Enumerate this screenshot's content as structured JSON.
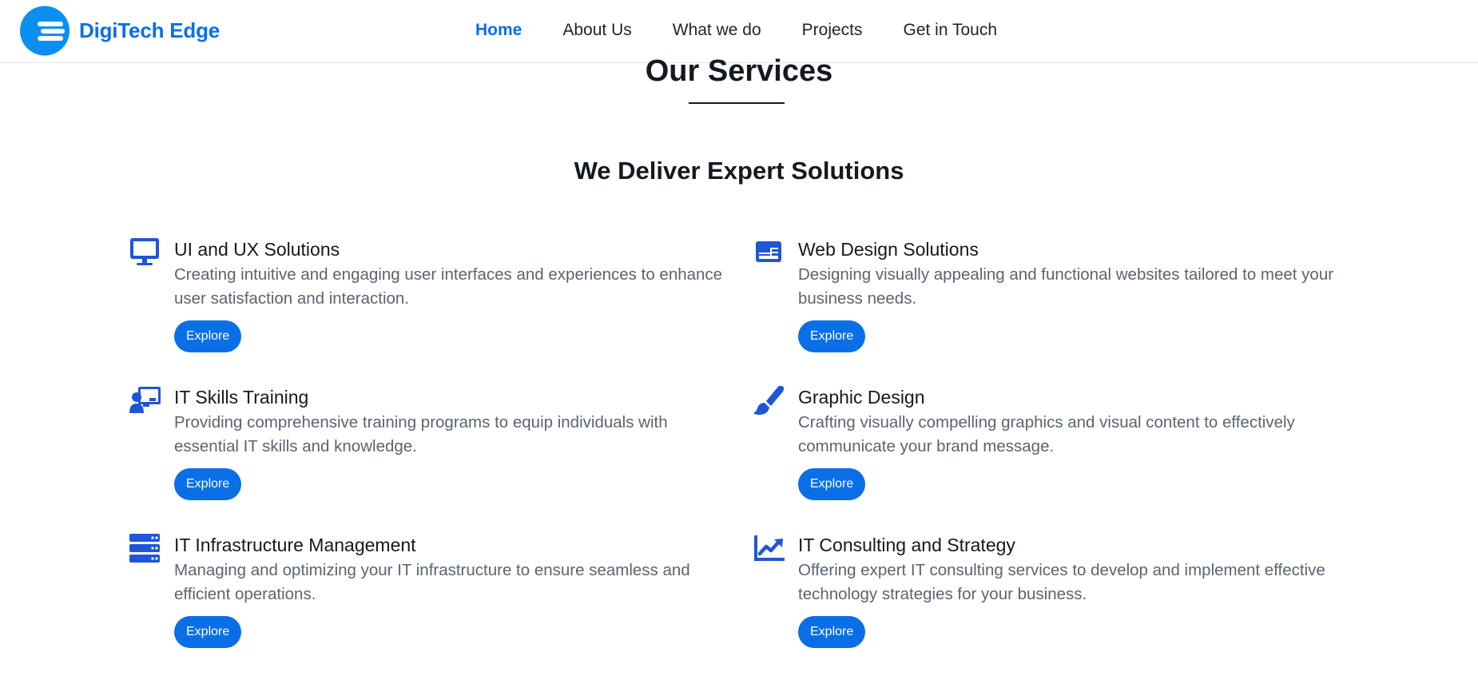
{
  "brand": {
    "name": "DigiTech Edge",
    "accent": "#0a6fe6"
  },
  "nav": {
    "items": [
      {
        "label": "Home",
        "active": true
      },
      {
        "label": "About Us",
        "active": false
      },
      {
        "label": "What we do",
        "active": false
      },
      {
        "label": "Projects",
        "active": false
      },
      {
        "label": "Get in Touch",
        "active": false
      }
    ]
  },
  "main": {
    "title": "Our Services",
    "subtitle": "We Deliver Expert Solutions",
    "services": [
      {
        "icon": "monitor-icon",
        "title": "UI and UX Solutions",
        "description": "Creating intuitive and engaging user interfaces and experiences to enhance user satisfaction and interaction.",
        "button": "Explore"
      },
      {
        "icon": "web-layout-icon",
        "title": "Web Design Solutions",
        "description": "Designing visually appealing and functional websites tailored to meet your business needs.",
        "button": "Explore"
      },
      {
        "icon": "teacher-board-icon",
        "title": "IT Skills Training",
        "description": "Providing comprehensive training programs to equip individuals with essential IT skills and knowledge.",
        "button": "Explore"
      },
      {
        "icon": "paint-brush-icon",
        "title": "Graphic Design",
        "description": "Crafting visually compelling graphics and visual content to effectively communicate your brand message.",
        "button": "Explore"
      },
      {
        "icon": "server-icon",
        "title": "IT Infrastructure Management",
        "description": "Managing and optimizing your IT infrastructure to ensure seamless and efficient operations.",
        "button": "Explore"
      },
      {
        "icon": "chart-line-icon",
        "title": "IT Consulting and Strategy",
        "description": "Offering expert IT consulting services to develop and implement effective technology strategies for your business.",
        "button": "Explore"
      }
    ]
  }
}
